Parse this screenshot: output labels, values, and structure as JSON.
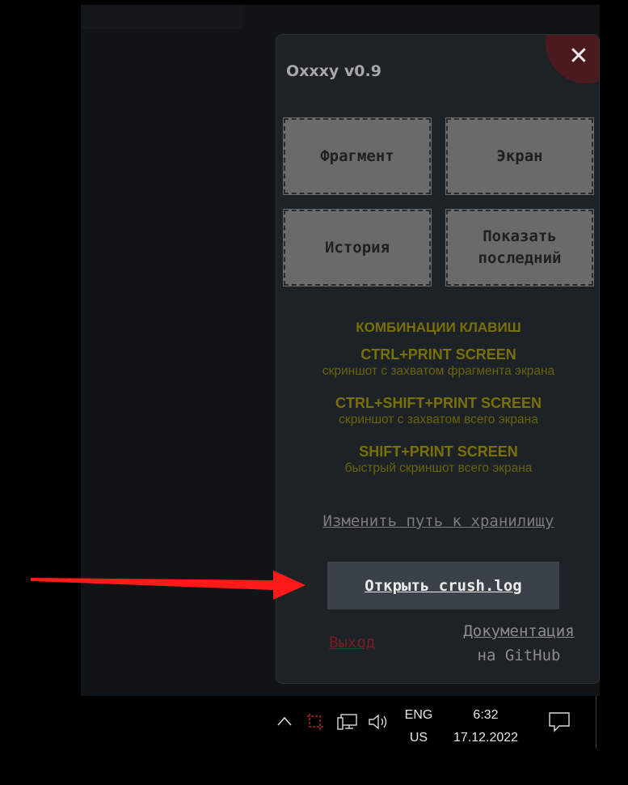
{
  "app": {
    "title": "Oxxxy v0.9",
    "close_glyph": "✕"
  },
  "buttons": {
    "fragment": "Фрагмент",
    "screen": "Экран",
    "history": "История",
    "show_last": "Показать последний"
  },
  "hotkeys": {
    "heading": "КОМБИНАЦИИ КЛАВИШ",
    "items": [
      {
        "keys": "CTRL+PRINT SCREEN",
        "description": "скриншот с захватом фрагмента экрана"
      },
      {
        "keys": "CTRL+SHIFT+PRINT SCREEN",
        "description": "скриншот с захватом всего экрана"
      },
      {
        "keys": "SHIFT+PRINT SCREEN",
        "description": "быстрый скриншот всего экрана"
      }
    ]
  },
  "links": {
    "change_storage": "Изменить путь к хранилищу",
    "open_crush_log": "Открыть crush.log",
    "exit": "Выход",
    "docs_line1": "Документация",
    "docs_line2": "на GitHub"
  },
  "taskbar": {
    "lang_line1": "ENG",
    "lang_line2": "US",
    "time": "6:32",
    "date": "17.12.2022",
    "icons": [
      "chevron-up-icon",
      "crop-screenshot-icon",
      "network-icon",
      "volume-icon",
      "notification-icon"
    ]
  },
  "colors": {
    "panel_bg": "#1d2227",
    "tile_bg": "#6a6a6a",
    "hotkey_text": "#7a7008",
    "exit_text": "#7a1d23",
    "crush_button_bg": "#3a4148",
    "arrow": "#ff1a1a"
  }
}
